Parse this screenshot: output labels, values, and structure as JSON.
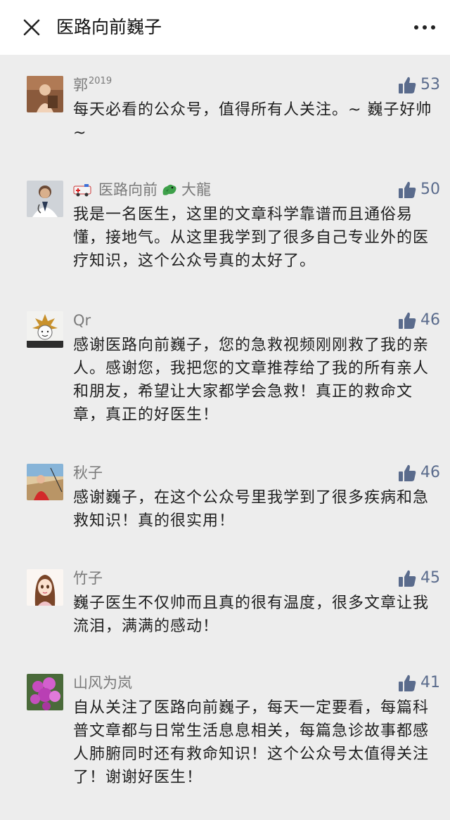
{
  "header": {
    "title": "医路向前巍子",
    "close_icon": "close-icon",
    "more_icon": "more-icon"
  },
  "comments": [
    {
      "name": "郭",
      "name_suffix": "2019",
      "likes": "53",
      "text": "每天必看的公众号，值得所有人关注。~ 巍子好帅 ~"
    },
    {
      "name_prefix_icon": "ambulance-emoji",
      "name": "医路向前",
      "name_mid_icon": "dragon-emoji",
      "name_after": "大龍",
      "likes": "50",
      "text": "我是一名医生，这里的文章科学靠谱而且通俗易懂，接地气。从这里我学到了很多自己专业外的医疗知识，这个公众号真的太好了。"
    },
    {
      "name": "Qr",
      "likes": "46",
      "text": "感谢医路向前巍子，您的急救视频刚刚救了我的亲人。感谢您，我把您的文章推荐给了我的所有亲人和朋友，希望让大家都学会急救！真正的救命文章，真正的好医生！"
    },
    {
      "name": "秋子",
      "likes": "46",
      "text": "感谢巍子，在这个公众号里我学到了很多疾病和急救知识！真的很实用！"
    },
    {
      "name": "竹子",
      "likes": "45",
      "text": "巍子医生不仅帅而且真的很有温度，很多文章让我流泪，满满的感动！"
    },
    {
      "name": "山风为岚",
      "likes": "41",
      "text": "自从关注了医路向前巍子，每天一定要看，每篇科普文章都与日常生活息息相关，每篇急诊故事都感人肺腑同时还有救命知识！这个公众号太值得关注了！谢谢好医生！"
    }
  ],
  "colors": {
    "like_count": "#5a6b8c",
    "username": "#7a7a7a",
    "background": "#ededed"
  }
}
